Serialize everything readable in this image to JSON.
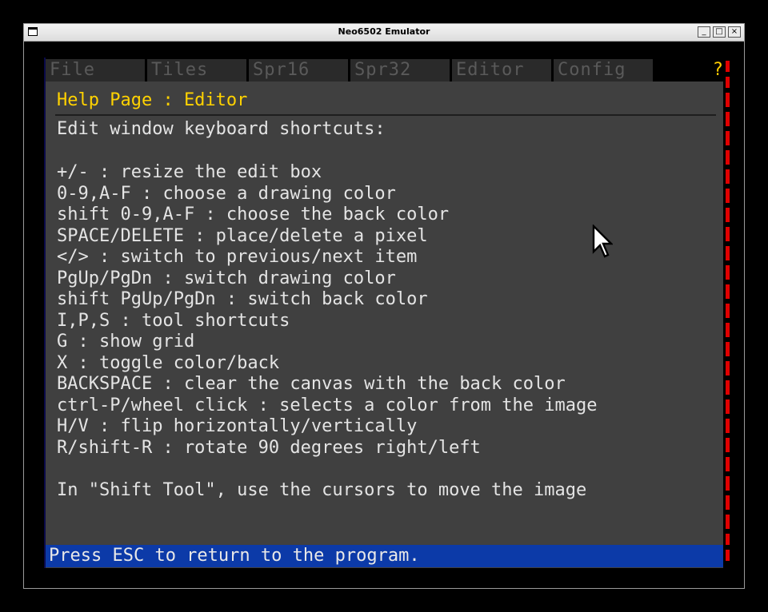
{
  "window": {
    "title": "Neo6502 Emulator",
    "minimize_glyph": "_",
    "maximize_glyph": "□",
    "close_glyph": "×"
  },
  "menu": {
    "items": [
      {
        "label": "File"
      },
      {
        "label": "Tiles"
      },
      {
        "label": "Spr16"
      },
      {
        "label": "Spr32"
      },
      {
        "label": "Editor"
      },
      {
        "label": "Config"
      }
    ],
    "help_label": "?"
  },
  "page": {
    "title": "Help Page : Editor",
    "lines": [
      "Edit window keyboard shortcuts:",
      "+/- : resize the edit box",
      "0-9,A-F : choose a drawing color",
      "shift 0-9,A-F : choose the back color",
      "SPACE/DELETE : place/delete a pixel",
      "</> : switch to previous/next item",
      "PgUp/PgDn : switch drawing color",
      "shift PgUp/PgDn : switch back color",
      "I,P,S : tool shortcuts",
      "G : show grid",
      "X : toggle color/back",
      "BACKSPACE : clear the canvas with the back color",
      "ctrl-P/wheel click : selects a color from the image",
      "H/V : flip horizontally/vertically",
      "R/shift-R : rotate 90 degrees right/left",
      "In \"Shift Tool\", use the cursors to move the image"
    ]
  },
  "status": {
    "text": "Press ESC to return to the program."
  },
  "colors": {
    "title_yellow": "#ffd200",
    "status_blue": "#0c3aa8",
    "panel_gray": "#404040",
    "marker_red": "#e00000"
  },
  "icons": {
    "app": "window-menu-icon",
    "pointer": "mouse-pointer-icon"
  }
}
